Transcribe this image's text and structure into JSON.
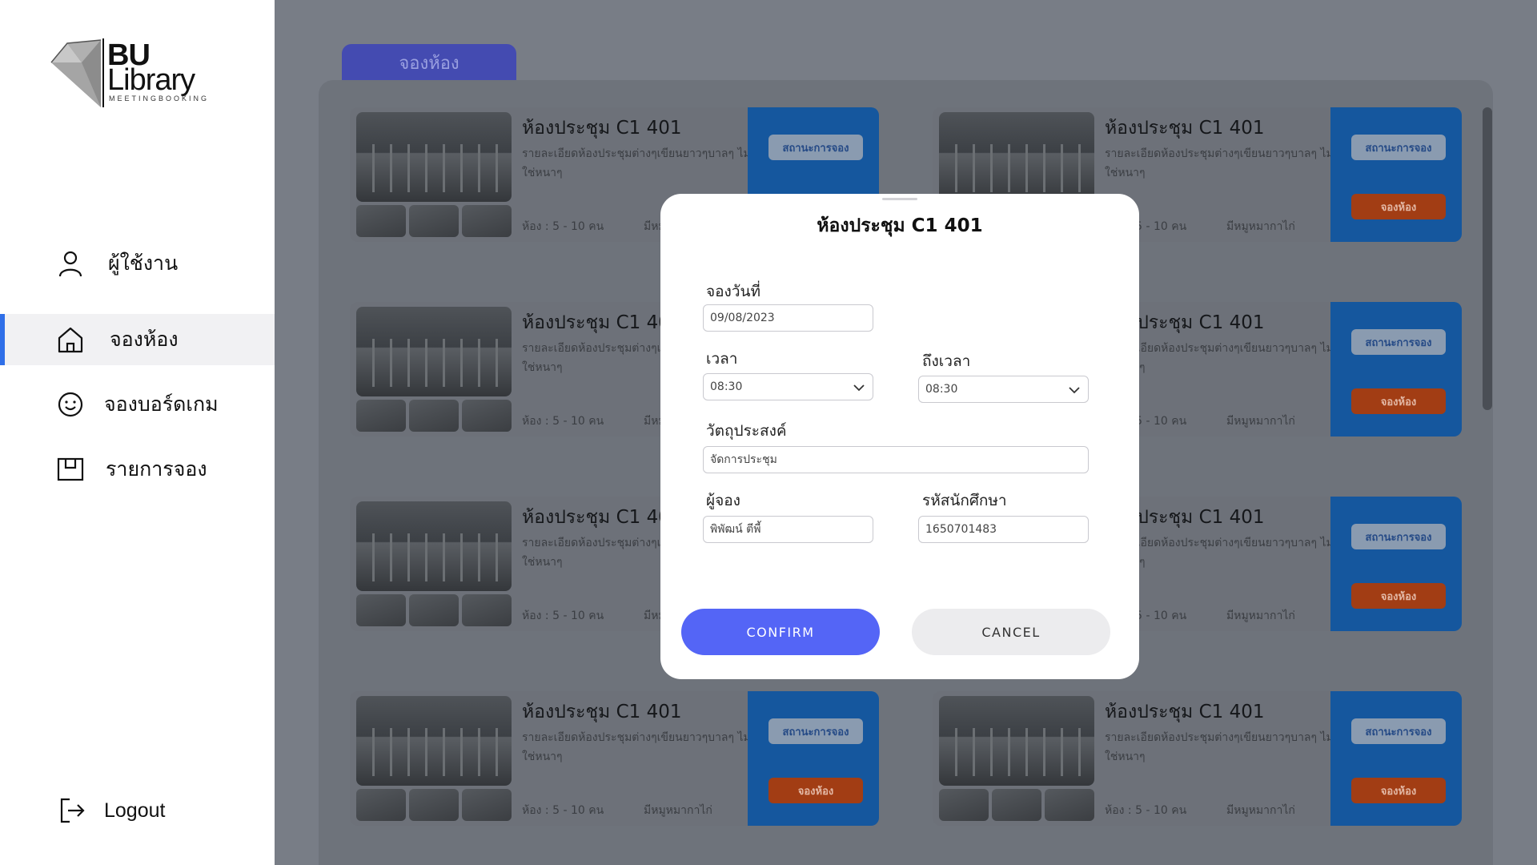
{
  "logo": {
    "line1": "BU",
    "line2": "Library",
    "subtitle": "MEETINGBOOKING"
  },
  "sidebar": {
    "items": [
      {
        "label": "ผู้ใช้งาน",
        "icon": "user-icon"
      },
      {
        "label": "จองห้อง",
        "icon": "home-icon",
        "active": true
      },
      {
        "label": "จองบอร์ดเกม",
        "icon": "smiley-icon"
      },
      {
        "label": "รายการจอง",
        "icon": "box-icon"
      }
    ],
    "logout": {
      "label": "Logout",
      "icon": "logout-icon"
    }
  },
  "main": {
    "tab_label": "จองห้อง"
  },
  "room_cards": [
    {
      "title": "ห้องประชุม C1 401",
      "desc": "รายละเอียดห้องประชุมต่างๆเขียนยาวๆบาลๆ ไม่ใช่หนาๆ",
      "capacity": "ห้อง : 5 - 10 คน",
      "extra": "มีหมูหมากาไก่",
      "status_label": "สถานะการจอง",
      "book_label": "จองห้อง"
    },
    {
      "title": "ห้องประชุม C1 401",
      "desc": "รายละเอียดห้องประชุมต่างๆเขียนยาวๆบาลๆ ไม่ใช่หนาๆ",
      "capacity": "ห้อง : 5 - 10 คน",
      "extra": "มีหมูหมากาไก่",
      "status_label": "สถานะการจอง",
      "book_label": "จองห้อง"
    },
    {
      "title": "ห้องประชุม C1 401",
      "desc": "รายละเอียดห้องประชุมต่างๆเขียนยาวๆบาลๆ ไม่ใช่หนาๆ",
      "capacity": "ห้อง : 5 - 10 คน",
      "extra": "มีหมูหมากาไก่",
      "status_label": "สถานะการจอง",
      "book_label": "จองห้อง"
    },
    {
      "title": "ห้องประชุม C1 401",
      "desc": "รายละเอียดห้องประชุมต่างๆเขียนยาวๆบาลๆ ไม่ใช่หนาๆ",
      "capacity": "ห้อง : 5 - 10 คน",
      "extra": "มีหมูหมากาไก่",
      "status_label": "สถานะการจอง",
      "book_label": "จองห้อง"
    },
    {
      "title": "ห้องประชุม C1 401",
      "desc": "รายละเอียดห้องประชุมต่างๆเขียนยาวๆบาลๆ ไม่ใช่หนาๆ",
      "capacity": "ห้อง : 5 - 10 คน",
      "extra": "มีหมูหมากาไก่",
      "status_label": "สถานะการจอง",
      "book_label": "จองห้อง"
    },
    {
      "title": "ห้องประชุม C1 401",
      "desc": "รายละเอียดห้องประชุมต่างๆเขียนยาวๆบาลๆ ไม่ใช่หนาๆ",
      "capacity": "ห้อง : 5 - 10 คน",
      "extra": "มีหมูหมากาไก่",
      "status_label": "สถานะการจอง",
      "book_label": "จองห้อง"
    },
    {
      "title": "ห้องประชุม C1 401",
      "desc": "รายละเอียดห้องประชุมต่างๆเขียนยาวๆบาลๆ ไม่ใช่หนาๆ",
      "capacity": "ห้อง : 5 - 10 คน",
      "extra": "มีหมูหมากาไก่",
      "status_label": "สถานะการจอง",
      "book_label": "จองห้อง"
    },
    {
      "title": "ห้องประชุม C1 401",
      "desc": "รายละเอียดห้องประชุมต่างๆเขียนยาวๆบาลๆ ไม่ใช่หนาๆ",
      "capacity": "ห้อง : 5 - 10 คน",
      "extra": "มีหมูหมากาไก่",
      "status_label": "สถานะการจอง",
      "book_label": "จองห้อง"
    }
  ],
  "modal": {
    "title": "ห้องประชุม C1 401",
    "date_label": "จองวันที่",
    "date_value": "09/08/2023",
    "time_label": "เวลา",
    "time_value": "08:30",
    "to_time_label": "ถึงเวลา",
    "to_time_value": "08:30",
    "purpose_label": "วัตถุประสงค์",
    "purpose_value": "จัดการประชุม",
    "booker_label": "ผู้จอง",
    "booker_value": "พิพัฒน์   ตีพี้",
    "student_id_label": "รหัสนักศึกษา",
    "student_id_value": "1650701483",
    "confirm_label": "CONFIRM",
    "cancel_label": "CANCEL"
  },
  "colors": {
    "accent": "#2f6fe8",
    "confirm": "#5465f6",
    "status_button": "#8a9bb0",
    "book_button": "#a23d14"
  }
}
